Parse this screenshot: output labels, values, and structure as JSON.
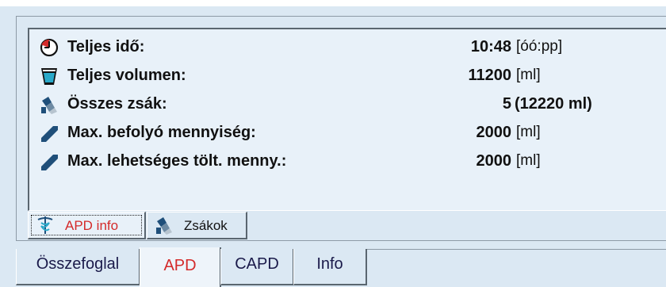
{
  "summary": {
    "rows": [
      {
        "icon": "clock-icon",
        "label": "Teljes idő:",
        "value": "10:48",
        "unit": "[óó:pp]"
      },
      {
        "icon": "cup-icon",
        "label": "Teljes volumen:",
        "value": "11200",
        "unit": "[ml]"
      },
      {
        "icon": "bags-icon",
        "label": "Összes zsák:",
        "value": "5",
        "unit": "(12220 ml)"
      },
      {
        "icon": "inflow-icon",
        "label": "Max. befolyó mennyiség:",
        "value": "2000",
        "unit": "[ml]"
      },
      {
        "icon": "fill-icon",
        "label": "Max. lehetséges tölt. menny.:",
        "value": "2000",
        "unit": "[ml]"
      }
    ]
  },
  "subtabs": [
    {
      "label": "APD info",
      "icon": "caduceus-icon",
      "active": true
    },
    {
      "label": "Zsákok",
      "icon": "bags-icon",
      "active": false
    }
  ],
  "maintabs": [
    {
      "label": "Összefoglal",
      "active": false
    },
    {
      "label": "APD",
      "active": true
    },
    {
      "label": "CAPD",
      "active": false
    },
    {
      "label": "Info",
      "active": false
    }
  ],
  "colors": {
    "active_tab_text": "#d42a2a",
    "subtab_active_text": "#d42a2a",
    "icon_blue": "#1f4f7a"
  }
}
